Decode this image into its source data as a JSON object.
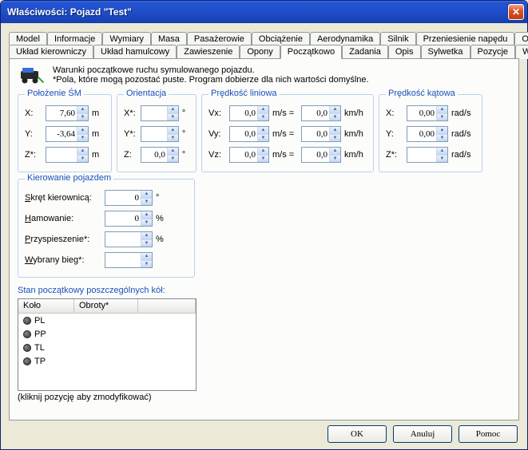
{
  "window": {
    "title": "Właściwości: Pojazd \"Test\""
  },
  "tabs_row1": [
    {
      "label": "Model"
    },
    {
      "label": "Informacje"
    },
    {
      "label": "Wymiary"
    },
    {
      "label": "Masa"
    },
    {
      "label": "Pasażerowie"
    },
    {
      "label": "Obciążenie"
    },
    {
      "label": "Aerodynamika"
    },
    {
      "label": "Silnik"
    },
    {
      "label": "Przeniesienie napędu"
    },
    {
      "label": "Osiągi"
    }
  ],
  "tabs_row2": [
    {
      "label": "Układ kierowniczy"
    },
    {
      "label": "Układ hamulcowy"
    },
    {
      "label": "Zawieszenie"
    },
    {
      "label": "Opony"
    },
    {
      "label": "Początkowo",
      "active": true
    },
    {
      "label": "Zadania"
    },
    {
      "label": "Opis"
    },
    {
      "label": "Sylwetka"
    },
    {
      "label": "Pozycje"
    },
    {
      "label": "Wygląd"
    }
  ],
  "intro": {
    "line1": "Warunki początkowe ruchu symulowanego pojazdu.",
    "line2": "*Pola, które mogą pozostać puste. Program dobierze dla nich wartości domyślne."
  },
  "groups": {
    "position": {
      "legend": "Położenie ŚM",
      "rows": [
        {
          "label": "X:",
          "value": "7,60",
          "unit": "m"
        },
        {
          "label": "Y:",
          "value": "-3,64",
          "unit": "m"
        },
        {
          "label": "Z*:",
          "value": "",
          "unit": "m"
        }
      ]
    },
    "orientation": {
      "legend": "Orientacja",
      "rows": [
        {
          "label": "X*:",
          "value": "",
          "unit": "°"
        },
        {
          "label": "Y*:",
          "value": "",
          "unit": "°"
        },
        {
          "label": "Z:",
          "value": "0,0",
          "unit": "°"
        }
      ]
    },
    "linear": {
      "legend": "Prędkość liniowa",
      "rows": [
        {
          "label": "Vx:",
          "v1": "0,0",
          "u1": "m/s =",
          "v2": "0,0",
          "u2": "km/h"
        },
        {
          "label": "Vy:",
          "v1": "0,0",
          "u1": "m/s =",
          "v2": "0,0",
          "u2": "km/h"
        },
        {
          "label": "Vz:",
          "v1": "0,0",
          "u1": "m/s =",
          "v2": "0,0",
          "u2": "km/h"
        }
      ]
    },
    "angular": {
      "legend": "Prędkość kątowa",
      "rows": [
        {
          "label": "X:",
          "value": "0,00",
          "unit": "rad/s"
        },
        {
          "label": "Y:",
          "value": "0,00",
          "unit": "rad/s"
        },
        {
          "label": "Z*:",
          "value": "",
          "unit": "rad/s"
        }
      ]
    },
    "steering": {
      "legend": "Kierowanie pojazdem",
      "rows": [
        {
          "label": "Skręt kierownicą:",
          "underline": "S",
          "value": "0",
          "unit": "°"
        },
        {
          "label": "Hamowanie:",
          "underline": "H",
          "value": "0",
          "unit": "%"
        },
        {
          "label": "Przyspieszenie*:",
          "underline": "P",
          "value": "",
          "unit": "%"
        },
        {
          "label": "Wybrany bieg*:",
          "underline": "W",
          "value": "",
          "unit": ""
        }
      ]
    }
  },
  "wheeltable": {
    "legend": "Stan początkowy poszczególnych kół:",
    "cols": [
      "Koło",
      "Obroty*"
    ],
    "rows": [
      "PL",
      "PP",
      "TL",
      "TP"
    ],
    "hint": "(kliknij pozycję aby zmodyfikować)"
  },
  "buttons": {
    "ok": "OK",
    "cancel": "Anuluj",
    "help": "Pomoc"
  }
}
